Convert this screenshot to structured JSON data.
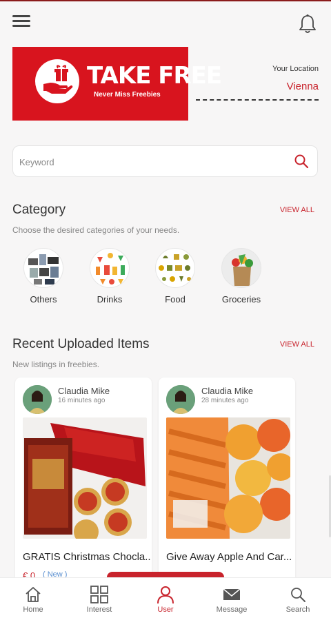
{
  "header": {
    "menu_icon": "hamburger-icon",
    "bell_icon": "bell-icon"
  },
  "banner": {
    "title": "TAKE FREE",
    "subtitle": "Never Miss Freebies",
    "background": "#d8141e"
  },
  "location": {
    "label": "Your Location",
    "value": "Vienna"
  },
  "search": {
    "placeholder": "Keyword",
    "icon": "search-icon"
  },
  "category": {
    "title": "Category",
    "view_all": "VIEW ALL",
    "subtitle": "Choose the desired categories of your needs.",
    "items": [
      {
        "label": "Others",
        "icon": "others-icon"
      },
      {
        "label": "Drinks",
        "icon": "drinks-icon"
      },
      {
        "label": "Food",
        "icon": "food-icon"
      },
      {
        "label": "Groceries",
        "icon": "groceries-icon"
      }
    ]
  },
  "recent": {
    "title": "Recent Uploaded Items",
    "view_all": "VIEW ALL",
    "subtitle": "New listings in freebies.",
    "items": [
      {
        "user": "Claudia Mike",
        "time": "16 minutes ago",
        "title": "GRATIS Christmas Chocla...",
        "price": "€ 0",
        "badge": "( New )"
      },
      {
        "user": "Claudia Mike",
        "time": "28 minutes ago",
        "title": "Give Away Apple And Car...",
        "price": "",
        "badge": ""
      }
    ]
  },
  "nav": {
    "active": "User",
    "items": [
      {
        "label": "Home",
        "icon": "home-icon"
      },
      {
        "label": "Interest",
        "icon": "grid-icon"
      },
      {
        "label": "User",
        "icon": "user-icon"
      },
      {
        "label": "Message",
        "icon": "mail-icon"
      },
      {
        "label": "Search",
        "icon": "search-icon"
      }
    ]
  },
  "colors": {
    "accent": "#c8232c",
    "badge": "#5a8fd0"
  }
}
